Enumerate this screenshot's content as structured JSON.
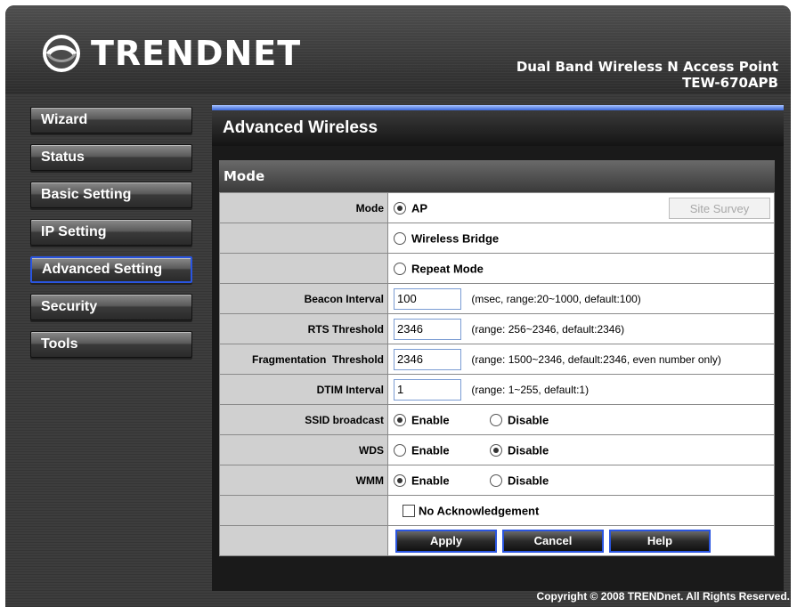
{
  "brand": {
    "logo_text": "TRENDNET"
  },
  "product": {
    "name": "Dual Band Wireless N Access Point",
    "model": "TEW-670APB"
  },
  "sidebar": {
    "items": [
      {
        "label": "Wizard"
      },
      {
        "label": "Status"
      },
      {
        "label": "Basic Setting"
      },
      {
        "label": "IP Setting"
      },
      {
        "label": "Advanced Setting",
        "active": true
      },
      {
        "label": "Security"
      },
      {
        "label": "Tools"
      }
    ]
  },
  "page": {
    "title": "Advanced Wireless",
    "section": "Mode"
  },
  "form": {
    "mode": {
      "label": "Mode",
      "options": [
        "AP",
        "Wireless Bridge",
        "Repeat Mode"
      ],
      "selected": "AP",
      "site_survey": "Site Survey"
    },
    "beacon_interval": {
      "label": "Beacon Interval",
      "value": "100",
      "hint": "(msec, range:20~1000, default:100)"
    },
    "rts_threshold": {
      "label": "RTS Threshold",
      "value": "2346",
      "hint": "(range: 256~2346, default:2346)"
    },
    "fragmentation_threshold": {
      "label": "Fragmentation  Threshold",
      "value": "2346",
      "hint": "(range: 1500~2346, default:2346, even number only)"
    },
    "dtim_interval": {
      "label": "DTIM Interval",
      "value": "1",
      "hint": "(range: 1~255, default:1)"
    },
    "ssid_broadcast": {
      "label": "SSID broadcast",
      "enable": "Enable",
      "disable": "Disable",
      "selected": "Enable"
    },
    "wds": {
      "label": "WDS",
      "enable": "Enable",
      "disable": "Disable",
      "selected": "Disable"
    },
    "wmm": {
      "label": "WMM",
      "enable": "Enable",
      "disable": "Disable",
      "selected": "Enable"
    },
    "no_ack": {
      "label": "No Acknowledgement",
      "checked": false
    }
  },
  "buttons": {
    "apply": "Apply",
    "cancel": "Cancel",
    "help": "Help"
  },
  "footer": {
    "copyright": "Copyright © 2008 TRENDnet. All Rights Reserved."
  },
  "colors": {
    "accent_blue": "#2a55e0",
    "frame": "#3a3a3a",
    "panel": "#c8c8c8"
  }
}
